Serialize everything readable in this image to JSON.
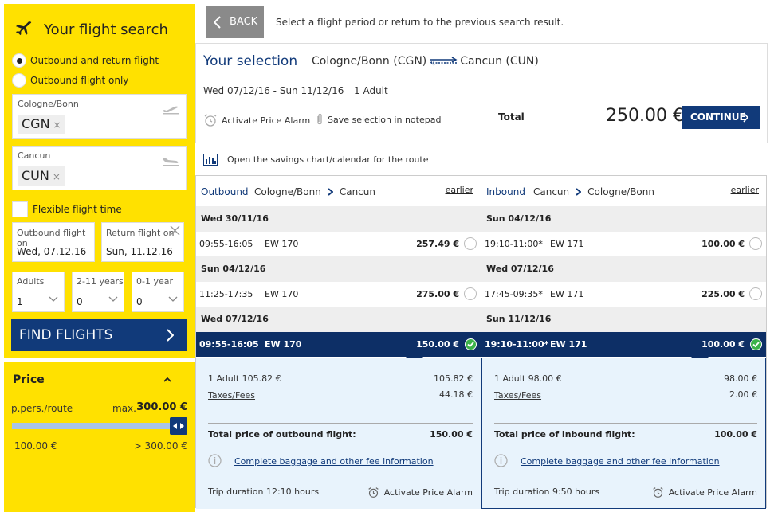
{
  "search": {
    "title": "Your flight search",
    "trip_options": [
      "Outbound and return flight",
      "Outbound flight only"
    ],
    "from_label": "Cologne/Bonn",
    "from_code": "CGN",
    "to_label": "Cancun",
    "to_code": "CUN",
    "chip_clear": "×",
    "flexible_label": "Flexible flight time",
    "outbound_label": "Outbound flight on",
    "outbound_value": "Wed, 07.12.16",
    "return_label": "Return flight on",
    "return_value": "Sun, 11.12.16",
    "adults_label": "Adults",
    "adults_value": "1",
    "children_label": "2-11 years",
    "children_value": "0",
    "infants_label": "0-1 year",
    "infants_value": "0",
    "find_label": "FIND FLIGHTS"
  },
  "price_filter": {
    "title": "Price",
    "per_route": "p.pers./route",
    "max_label": "max.",
    "max_value": "300.00 €",
    "min_label": "100.00 €",
    "max_range_label": "> 300.00 €",
    "slider_level": 1.0
  },
  "topbar": {
    "back_label": "BACK",
    "hint": "Select a flight period or return to the previous search result."
  },
  "selection": {
    "title": "Your selection",
    "from": "Cologne/Bonn (CGN)",
    "to": "Cancun (CUN)",
    "dates": "Wed 07/12/16 - Sun 11/12/16",
    "pax": "1 Adult",
    "alarm": "Activate Price Alarm",
    "notepad": "Save selection in notepad",
    "total_label": "Total",
    "total_value": "250.00 €",
    "continue_label": "CONTINUE"
  },
  "savings_link": "Open the savings chart/calendar for the route",
  "outbound": {
    "dir": "Outbound",
    "from": "Cologne/Bonn",
    "to": "Cancun",
    "earlier": "earlier",
    "days": [
      {
        "date": "Wed 30/11/16",
        "time": "09:55-16:05",
        "flight": "EW 170",
        "price": "257.49 €"
      },
      {
        "date": "Sun 04/12/16",
        "time": "11:25-17:35",
        "flight": "EW 170",
        "price": "275.00 €"
      },
      {
        "date": "Wed 07/12/16",
        "time": "09:55-16:05",
        "flight": "EW 170",
        "price": "150.00 €"
      }
    ],
    "detail": {
      "adult_line": "1 Adult 105.82 €",
      "adult_value": "105.82 €",
      "taxes_label": "Taxes/Fees",
      "taxes_value": "44.18 €",
      "total_label": "Total price of outbound flight:",
      "total_value": "150.00 €",
      "baggage_link": "Complete baggage and other fee information",
      "duration": "Trip duration 12:10  hours",
      "alarm": "Activate Price Alarm"
    }
  },
  "inbound": {
    "dir": "Inbound",
    "from": "Cancun",
    "to": "Cologne/Bonn",
    "earlier": "earlier",
    "days": [
      {
        "date": "Sun 04/12/16",
        "time": "19:10-11:00*",
        "flight": "EW 171",
        "price": "100.00 €"
      },
      {
        "date": "Wed 07/12/16",
        "time": "17:45-09:35*",
        "flight": "EW 171",
        "price": "225.00 €"
      },
      {
        "date": "Sun 11/12/16",
        "time": "19:10-11:00*",
        "flight": "EW 171",
        "price": "100.00 €"
      }
    ],
    "detail": {
      "adult_line": "1 Adult 98.00 €",
      "adult_value": "98.00 €",
      "taxes_label": "Taxes/Fees",
      "taxes_value": "2.00 €",
      "total_label": "Total price of inbound flight:",
      "total_value": "100.00 €",
      "baggage_link": "Complete baggage and other fee information",
      "duration": "Trip duration 9:50  hours",
      "alarm": "Activate Price Alarm"
    }
  },
  "colors": {
    "yellow": "#ffe100",
    "navy": "#113a7a",
    "selected_row": "#0d2f66",
    "detail_bg": "#e8f3fc",
    "check_green": "#3cb34a"
  }
}
